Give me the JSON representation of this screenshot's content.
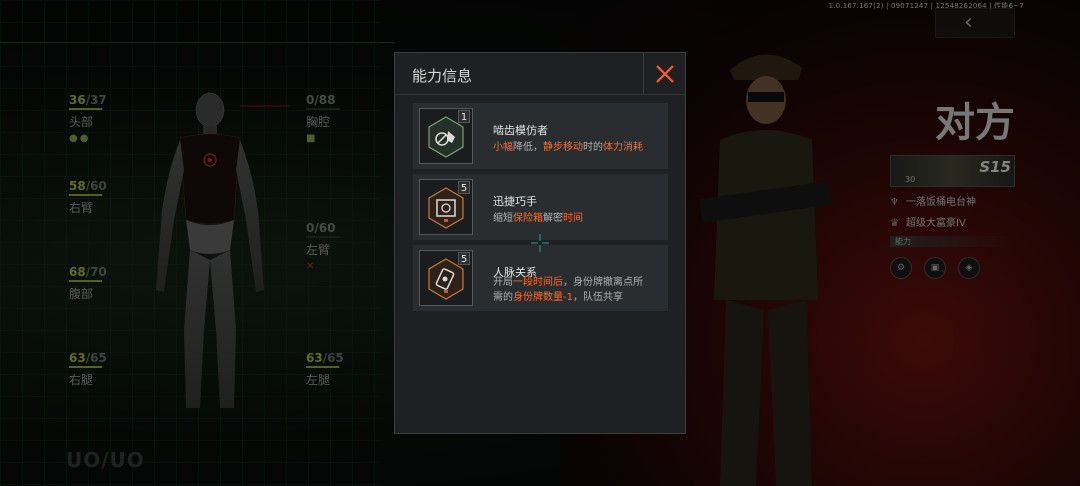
{
  "version_info": "1.0.167.167(2) | 09071247 | 12548262064 | 性能6~7",
  "back_icon": "chevron-left-icon",
  "body_stats": [
    {
      "id": "head",
      "current": "36",
      "max": "/37",
      "label": "头部",
      "fill": 0.97
    },
    {
      "id": "chest",
      "current": "0",
      "max": "/88",
      "label": "胸腔",
      "fill": 0
    },
    {
      "id": "right-arm",
      "current": "58",
      "max": "/60",
      "label": "右臂",
      "fill": 0.97
    },
    {
      "id": "left-arm",
      "current": "0",
      "max": "/60",
      "label": "左臂",
      "fill": 0
    },
    {
      "id": "abdomen",
      "current": "68",
      "max": "/70",
      "label": "腹部",
      "fill": 0.97
    },
    {
      "id": "right-leg",
      "current": "63",
      "max": "/65",
      "label": "右腿",
      "fill": 0.97
    },
    {
      "id": "left-leg",
      "current": "63",
      "max": "/65",
      "label": "左腿",
      "fill": 0.97
    }
  ],
  "left_arm_status": "✕",
  "bottom_left_text": "UO/UO",
  "enemy": {
    "title": "对方",
    "rank": "S15",
    "level": "30",
    "player_name": "一落饭桶电台神",
    "rank_title": "超级大富豪IV",
    "ability_label": "能力"
  },
  "modal": {
    "title": "能力信息",
    "close_icon": "close-icon",
    "abilities": [
      {
        "level": "1",
        "name": "啮齿模仿者",
        "desc_lines": [
          [
            {
              "t": "小幅",
              "hl": true
            },
            {
              "t": "降低，",
              "hl": false
            },
            {
              "t": "静步移动",
              "hl": true
            },
            {
              "t": "时的",
              "hl": false
            },
            {
              "t": "体力消耗",
              "hl": true
            }
          ]
        ]
      },
      {
        "level": "5",
        "name": "迅捷巧手",
        "desc_lines": [
          [
            {
              "t": "缩短",
              "hl": false
            },
            {
              "t": "保险箱",
              "hl": true
            },
            {
              "t": "解密",
              "hl": false
            },
            {
              "t": "时间",
              "hl": true
            }
          ]
        ]
      },
      {
        "level": "5",
        "name": "人脉关系",
        "desc_lines": [
          [
            {
              "t": "开局",
              "hl": false
            },
            {
              "t": "一段时间后",
              "hl": true
            },
            {
              "t": "，身份牌撤离点所",
              "hl": false
            }
          ],
          [
            {
              "t": "需的",
              "hl": false
            },
            {
              "t": "身份牌数量-1",
              "hl": true
            },
            {
              "t": "，队伍共享",
              "hl": false
            }
          ]
        ]
      }
    ]
  },
  "colors": {
    "highlight": "#ff6a2b",
    "close": "#ff5a2a",
    "health": "#b7c24a"
  }
}
